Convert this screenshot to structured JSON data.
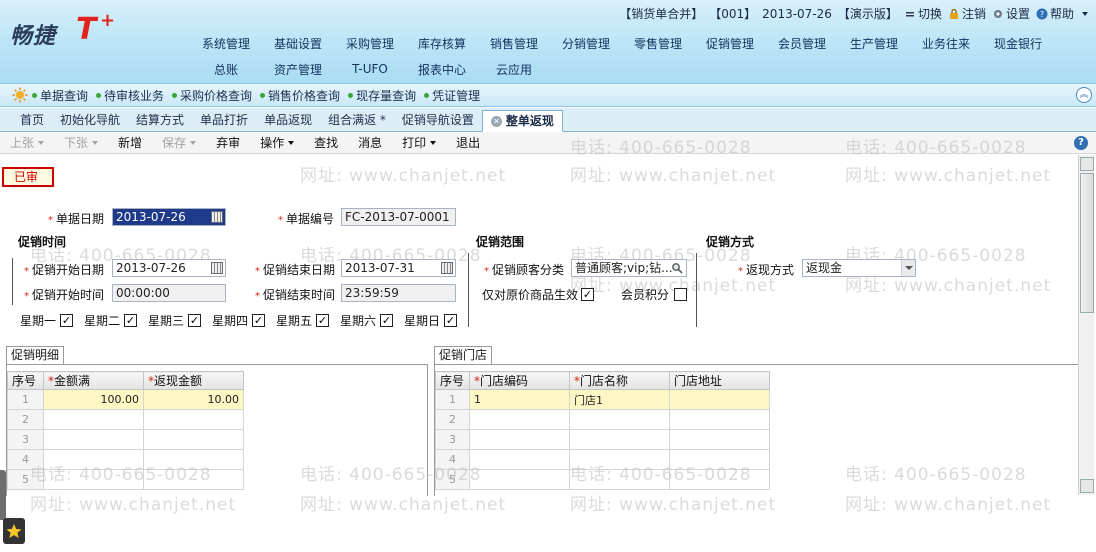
{
  "header": {
    "logo_text": "畅捷",
    "logo_t": "T",
    "logo_plus": "+",
    "info": {
      "merge": "【销货单合并】",
      "account": "【001】",
      "date": "2013-07-26",
      "mode": "【演示版】",
      "switch": "切换",
      "logout": "注销",
      "settings": "设置",
      "help": "帮助"
    },
    "menu_row1": [
      "系统管理",
      "基础设置",
      "采购管理",
      "库存核算",
      "销售管理",
      "分销管理",
      "零售管理",
      "促销管理",
      "会员管理",
      "生产管理",
      "业务往来",
      "现金银行"
    ],
    "menu_row2": [
      "总账",
      "资产管理",
      "T-UFO",
      "报表中心",
      "云应用"
    ]
  },
  "shortcuts": [
    "单据查询",
    "待审核业务",
    "采购价格查询",
    "销售价格查询",
    "现存量查询",
    "凭证管理"
  ],
  "tabs": [
    "首页",
    "初始化导航",
    "结算方式",
    "单品打折",
    "单品返现",
    "组合满返 *",
    "促销导航设置",
    "整单返现"
  ],
  "toolbar": {
    "shelve_up": "上张",
    "shelve_down": "下张",
    "add": "新增",
    "save": "保存",
    "discard": "弃审",
    "operate": "操作",
    "find": "查找",
    "message": "消息",
    "print": "打印",
    "exit": "退出"
  },
  "status": "已审",
  "form": {
    "doc_date_label": "单据日期",
    "doc_date": "2013-07-26",
    "doc_no_label": "单据编号",
    "doc_no": "FC-2013-07-0001",
    "promo_time_title": "促销时间",
    "start_date_label": "促销开始日期",
    "start_date": "2013-07-26",
    "end_date_label": "促销结束日期",
    "end_date": "2013-07-31",
    "start_time_label": "促销开始时间",
    "start_time": "00:00:00",
    "end_time_label": "促销结束时间",
    "end_time": "23:59:59",
    "weekdays": [
      "星期一",
      "星期二",
      "星期三",
      "星期四",
      "星期五",
      "星期六",
      "星期日"
    ],
    "check_mark": "✓",
    "scope_title": "促销范围",
    "customer_class_label": "促销顾客分类",
    "customer_class": "普通顾客;vip;钻...",
    "original_only_label": "仅对原价商品生效",
    "member_points_label": "会员积分",
    "method_title": "促销方式",
    "return_method_label": "返现方式",
    "return_method": "返现金"
  },
  "detail": {
    "tab": "促销明细",
    "columns": [
      "序号",
      "金额满",
      "返现金额"
    ],
    "rows": [
      {
        "no": "1",
        "amount": "100.00",
        "cashback": "10.00"
      },
      {
        "no": "2",
        "amount": "",
        "cashback": ""
      },
      {
        "no": "3",
        "amount": "",
        "cashback": ""
      },
      {
        "no": "4",
        "amount": "",
        "cashback": ""
      },
      {
        "no": "5",
        "amount": "",
        "cashback": ""
      }
    ]
  },
  "stores": {
    "tab": "促销门店",
    "columns": [
      "序号",
      "门店编码",
      "门店名称",
      "门店地址"
    ],
    "rows": [
      {
        "no": "1",
        "code": "1",
        "name": "门店1",
        "addr": ""
      },
      {
        "no": "2",
        "code": "",
        "name": "",
        "addr": ""
      },
      {
        "no": "3",
        "code": "",
        "name": "",
        "addr": ""
      },
      {
        "no": "4",
        "code": "",
        "name": "",
        "addr": ""
      },
      {
        "no": "5",
        "code": "",
        "name": "",
        "addr": ""
      }
    ]
  },
  "watermark": {
    "phone": "电话: 400-665-0028",
    "site": "网址: www.chanjet.net"
  }
}
